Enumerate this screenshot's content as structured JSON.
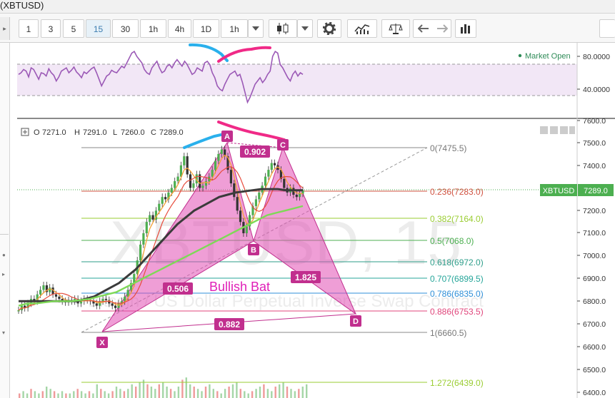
{
  "window": {
    "title": "(XBTUSD)"
  },
  "toolbar": {
    "intervals": [
      "1",
      "3",
      "5",
      "15",
      "30",
      "1h",
      "4h",
      "1D",
      "1h"
    ],
    "active_interval": "15"
  },
  "icons": [
    "chevron-down-icon",
    "candles-icon",
    "gear-icon",
    "indicators-icon",
    "compare-icon",
    "undo-icon",
    "redo-icon",
    "bar-chart-icon",
    "plus-square-icon"
  ],
  "rsi": {
    "legend": "Market Open",
    "scale_labels": [
      "80.0000",
      "40.0000"
    ],
    "series": [
      58,
      60,
      64,
      62,
      55,
      66,
      64,
      58,
      52,
      60,
      59,
      56,
      65,
      60,
      57,
      50,
      55,
      62,
      64,
      66,
      60,
      63,
      67,
      61,
      58,
      54,
      61,
      59,
      62,
      65,
      67,
      60,
      52,
      44,
      50,
      56,
      58,
      63,
      61,
      60,
      64,
      68,
      66,
      72,
      78,
      84,
      86,
      80,
      76,
      72,
      64,
      60,
      58,
      66,
      70,
      74,
      66,
      60,
      62,
      68,
      70,
      66,
      72,
      76,
      72,
      68,
      74,
      70,
      64,
      58,
      60,
      66,
      64,
      62,
      72,
      74,
      70,
      60,
      54,
      44,
      40,
      38,
      46,
      52,
      58,
      60,
      62,
      56,
      58,
      48,
      36,
      24,
      30,
      38,
      46,
      50,
      54,
      48,
      52,
      58,
      62,
      80,
      86,
      84,
      70,
      66,
      60,
      54,
      50,
      58,
      62,
      56,
      60,
      58
    ]
  },
  "chart": {
    "ohlc": {
      "o_label": "O",
      "o": "7271.0",
      "h_label": "H",
      "h": "7291.0",
      "l_label": "L",
      "l": "7260.0",
      "c_label": "C",
      "c": "7289.0"
    },
    "symbol_badge": "XBTUSD",
    "price_badge": "7289.0",
    "price_axis": [
      "7600.0",
      "7500.0",
      "7400.0",
      "7300.0",
      "7200.0",
      "7100.0",
      "7000.0",
      "6900.0",
      "6800.0",
      "6700.0",
      "6600.0",
      "6500.0",
      "6400.0"
    ],
    "watermark": "XBTUSD, 15",
    "watermark_sub": "Bitcoin / US Dollar Perpetual Inverse Swap Contract",
    "pattern_name": "Bullish Bat",
    "points": {
      "X": "X",
      "A": "A",
      "B": "B",
      "C": "C",
      "D": "D"
    },
    "ratios": {
      "xa_bd": "0.506",
      "ac": "0.902",
      "bd": "1.825",
      "xd": "0.882"
    },
    "fib_levels": [
      {
        "text": "0(7475.5)",
        "color": "#777777"
      },
      {
        "text": "0.236(7283.0)",
        "color": "#d0503f"
      },
      {
        "text": "0.382(7164.0)",
        "color": "#9acd32"
      },
      {
        "text": "0.5(7068.0)",
        "color": "#4caf50"
      },
      {
        "text": "0.618(6972.0)",
        "color": "#2e9e8a"
      },
      {
        "text": "0.707(6899.5)",
        "color": "#26a69a"
      },
      {
        "text": "0.786(6835.0)",
        "color": "#2f8fd8"
      },
      {
        "text": "0.886(6753.5)",
        "color": "#e0457b"
      },
      {
        "text": "1(6660.5)",
        "color": "#777777"
      },
      {
        "text": "1.272(6439.0)",
        "color": "#9acd32"
      }
    ],
    "price_series": [
      6760,
      6780,
      6770,
      6790,
      6810,
      6800,
      6830,
      6850,
      6870,
      6840,
      6860,
      6830,
      6820,
      6810,
      6800,
      6795,
      6805,
      6800,
      6810,
      6790,
      6800,
      6810,
      6805,
      6800,
      6790,
      6780,
      6800,
      6810,
      6805,
      6790,
      6780,
      6770,
      6790,
      6800,
      6820,
      6850,
      6880,
      6920,
      6980,
      7050,
      7100,
      7150,
      7180,
      7160,
      7200,
      7230,
      7260,
      7250,
      7280,
      7300,
      7330,
      7350,
      7400,
      7440,
      7360,
      7300,
      7320,
      7360,
      7300,
      7310,
      7330,
      7350,
      7380,
      7420,
      7450,
      7470,
      7440,
      7380,
      7320,
      7260,
      7200,
      7150,
      7100,
      7130,
      7180,
      7220,
      7250,
      7280,
      7310,
      7350,
      7380,
      7410,
      7400,
      7380,
      7340,
      7300,
      7280,
      7300,
      7270,
      7260,
      7275,
      7290
    ],
    "ma_black": [
      6800,
      6800,
      6800,
      6800,
      6800,
      6800,
      6800,
      6800,
      6810,
      6820,
      6840,
      6860,
      6880,
      6910,
      6940,
      6980,
      7020,
      7060,
      7100,
      7140,
      7170,
      7200,
      7220,
      7240,
      7260,
      7270,
      7280,
      7285,
      7290,
      7295,
      7295,
      7295,
      7290,
      7290,
      7290
    ],
    "ma_green": [
      6780,
      6790,
      6790,
      6795,
      6800,
      6800,
      6800,
      6805,
      6810,
      6820,
      6830,
      6840,
      6860,
      6880,
      6900,
      6920,
      6940,
      6960,
      6980,
      7000,
      7020,
      7040,
      7060,
      7080,
      7100,
      7120,
      7140,
      7160,
      7180,
      7190,
      7200,
      7210,
      7220
    ],
    "volume": [
      2,
      3,
      2,
      4,
      3,
      2,
      3,
      5,
      4,
      3,
      2,
      3,
      2,
      2,
      3,
      4,
      3,
      2,
      3,
      2,
      6,
      4,
      3,
      2,
      3,
      5,
      4,
      3,
      4,
      6,
      5,
      7,
      8,
      6,
      5,
      4,
      6,
      7,
      5,
      4,
      3,
      5,
      8,
      9,
      6,
      5,
      4,
      3,
      5,
      6,
      4,
      3,
      2,
      4,
      5,
      6,
      7,
      4,
      3,
      2,
      3,
      4,
      5,
      6,
      4,
      3,
      5,
      6,
      7,
      5,
      4,
      3,
      4,
      5,
      6
    ]
  }
}
